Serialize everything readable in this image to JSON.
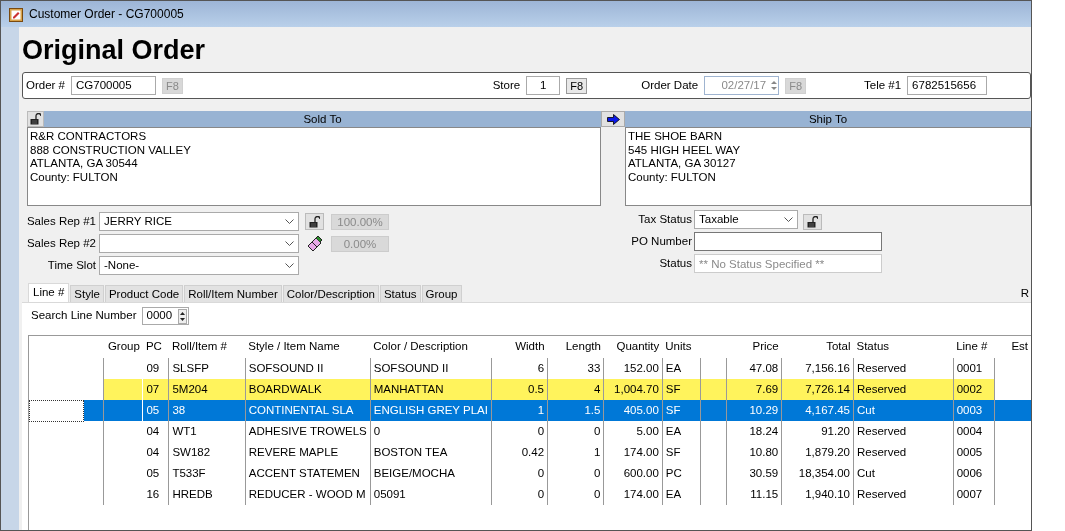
{
  "window": {
    "title": "Customer Order - CG700005"
  },
  "heading": "Original Order",
  "order_fields": [
    {
      "kind": "text",
      "label": "Order #",
      "value": "CG700005",
      "button": "F8",
      "button_disabled": true
    },
    {
      "kind": "text",
      "label": "Store",
      "value": "1",
      "button": "F8",
      "button_disabled": false
    },
    {
      "kind": "date",
      "label": "Order Date",
      "value": "02/27/17",
      "button": "F8",
      "button_disabled": true
    },
    {
      "kind": "text",
      "label": "Tele #1",
      "value": "6782515656"
    }
  ],
  "sold_to": {
    "title": "Sold To",
    "lines": [
      "R&R CONTRACTORS",
      "888 CONSTRUCTION VALLEY",
      "ATLANTA, GA  30544",
      "County: FULTON"
    ]
  },
  "ship_to": {
    "title": "Ship To",
    "lines": [
      "THE SHOE BARN",
      "545 HIGH HEEL WAY",
      "ATLANTA, GA  30127",
      "County: FULTON"
    ]
  },
  "sales_reps": [
    {
      "label": "Sales Rep #1",
      "value": "JERRY RICE",
      "percent": "100.00%"
    },
    {
      "label": "Sales Rep #2",
      "percent": "0.00%"
    }
  ],
  "time_slot": {
    "label": "Time Slot",
    "value": "-None-"
  },
  "tax_status": {
    "label": "Tax Status",
    "value": "Taxable"
  },
  "po_number": {
    "label": "PO Number"
  },
  "status": {
    "label": "Status",
    "placeholder": "** No Status Specified **"
  },
  "tabs": [
    {
      "label": "Line #",
      "selected": true
    },
    {
      "label": "Style",
      "selected": false
    },
    {
      "label": "Product Code",
      "selected": false
    },
    {
      "label": "Roll/Item Number",
      "selected": false
    },
    {
      "label": "Color/Description",
      "selected": false
    },
    {
      "label": "Status",
      "selected": false
    },
    {
      "label": "Group",
      "selected": false
    }
  ],
  "edge_label": "R",
  "search": {
    "label": "Search Line Number",
    "value": "0000"
  },
  "grid": {
    "columns": [
      "Group",
      "PC",
      "Roll/Item #",
      "Style / Item Name",
      "Color / Description",
      "Width",
      "Length",
      "Quantity",
      "Units",
      "Price",
      "Total",
      "Status",
      "Line #",
      "Est"
    ],
    "rows": [
      {
        "highlighted": false,
        "selected": false,
        "cells": [
          "",
          "09",
          "SLSFP",
          "SOFSOUND II",
          "SOFSOUND II",
          "6",
          "33",
          "152.00",
          "EA",
          "47.08",
          "7,156.16",
          "Reserved",
          "0001"
        ]
      },
      {
        "highlighted": true,
        "selected": false,
        "cells": [
          "",
          "07",
          "5M204",
          "BOARDWALK",
          "MANHATTAN",
          "0.5",
          "4",
          "1,004.70",
          "SF",
          "7.69",
          "7,726.14",
          "Reserved",
          "0002"
        ]
      },
      {
        "highlighted": false,
        "selected": true,
        "cells": [
          "",
          "05",
          "38",
          "CONTINENTAL SLA",
          "ENGLISH GREY PLAI",
          "1",
          "1.5",
          "405.00",
          "SF",
          "10.29",
          "4,167.45",
          "Cut",
          "0003"
        ]
      },
      {
        "highlighted": false,
        "selected": false,
        "cells": [
          "",
          "04",
          "WT1",
          "ADHESIVE TROWELS",
          "0",
          "0",
          "0",
          "5.00",
          "EA",
          "18.24",
          "91.20",
          "Reserved",
          "0004"
        ]
      },
      {
        "highlighted": false,
        "selected": false,
        "cells": [
          "",
          "04",
          "SW182",
          "REVERE MAPLE",
          "BOSTON TEA",
          "0.42",
          "1",
          "174.00",
          "SF",
          "10.80",
          "1,879.20",
          "Reserved",
          "0005"
        ]
      },
      {
        "highlighted": false,
        "selected": false,
        "cells": [
          "",
          "05",
          "T533F",
          "ACCENT STATEMEN",
          "BEIGE/MOCHA",
          "0",
          "0",
          "600.00",
          "PC",
          "30.59",
          "18,354.00",
          "Cut",
          "0006"
        ]
      },
      {
        "highlighted": false,
        "selected": false,
        "cells": [
          "",
          "16",
          "HREDB",
          "REDUCER - WOOD M",
          "05091",
          "0",
          "0",
          "174.00",
          "EA",
          "11.15",
          "1,940.10",
          "Reserved",
          "0007"
        ]
      }
    ]
  }
}
